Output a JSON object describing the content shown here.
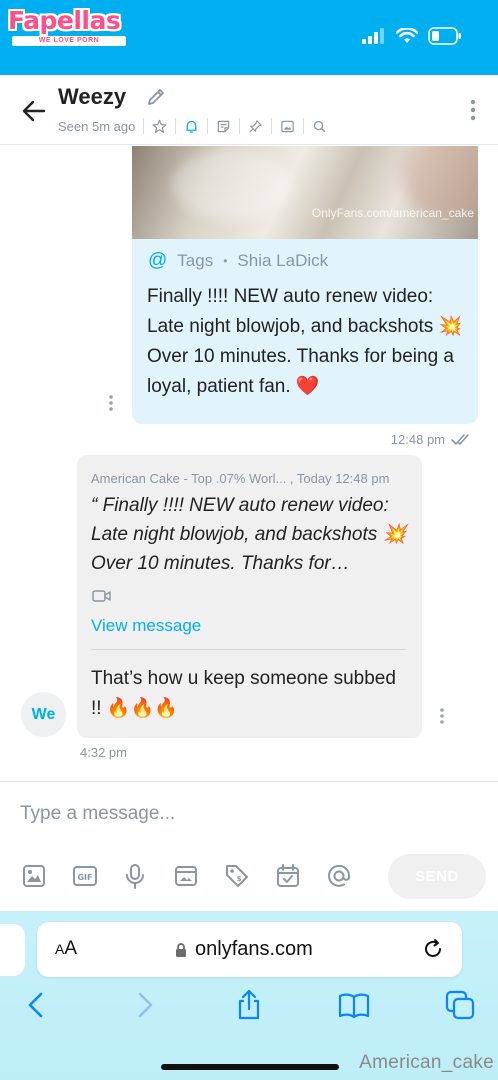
{
  "status_bar": {
    "logo_text": "Fapellas",
    "logo_tagline": "WE LOVE PORN"
  },
  "header": {
    "name": "Weezy",
    "seen": "Seen 5m ago"
  },
  "outgoing_message": {
    "watermark": "OnlyFans.com/american_cake",
    "tags_label": "Tags",
    "tagged_user": "Shia LaDick",
    "text": "Finally !!!! NEW auto renew video: Late night blowjob, and backshots 💥 Over 10 minutes. Thanks for being a loyal, patient fan. ❤️",
    "time": "12:48 pm"
  },
  "incoming_message": {
    "quote_meta": "American Cake - Top .07% Worl... , Today 12:48 pm",
    "quote_text": "“ Finally !!!! NEW auto renew video: Late night blowjob, and backshots 💥 Over 10 minutes. Thanks for…",
    "view_message_label": "View message",
    "reply_text": "That’s how u keep someone subbed !! 🔥🔥🔥",
    "avatar_initials": "We",
    "time": "4:32 pm"
  },
  "composer": {
    "placeholder": "Type a message...",
    "send_label": "SEND"
  },
  "browser": {
    "aa_label": "AA",
    "url": "onlyfans.com"
  },
  "corner_watermark": "American_cake",
  "colors": {
    "brand": "#00aff0",
    "bubble_out": "#e1f4fc",
    "bubble_in": "#f0f0f1",
    "logo_pink": "#ff4f8b"
  },
  "icons": [
    "signal-icon",
    "wifi-icon",
    "battery-icon",
    "back-arrow-icon",
    "pencil-icon",
    "star-icon",
    "bell-icon",
    "note-icon",
    "pin-icon",
    "image-icon",
    "search-icon",
    "more-vertical-icon",
    "at-icon",
    "double-check-icon",
    "video-icon",
    "gif-icon",
    "microphone-icon",
    "vault-icon",
    "price-tag-icon",
    "calendar-icon",
    "lock-icon",
    "reload-icon",
    "chevron-left-icon",
    "chevron-right-icon",
    "share-icon",
    "bookmarks-icon",
    "tabs-icon"
  ]
}
